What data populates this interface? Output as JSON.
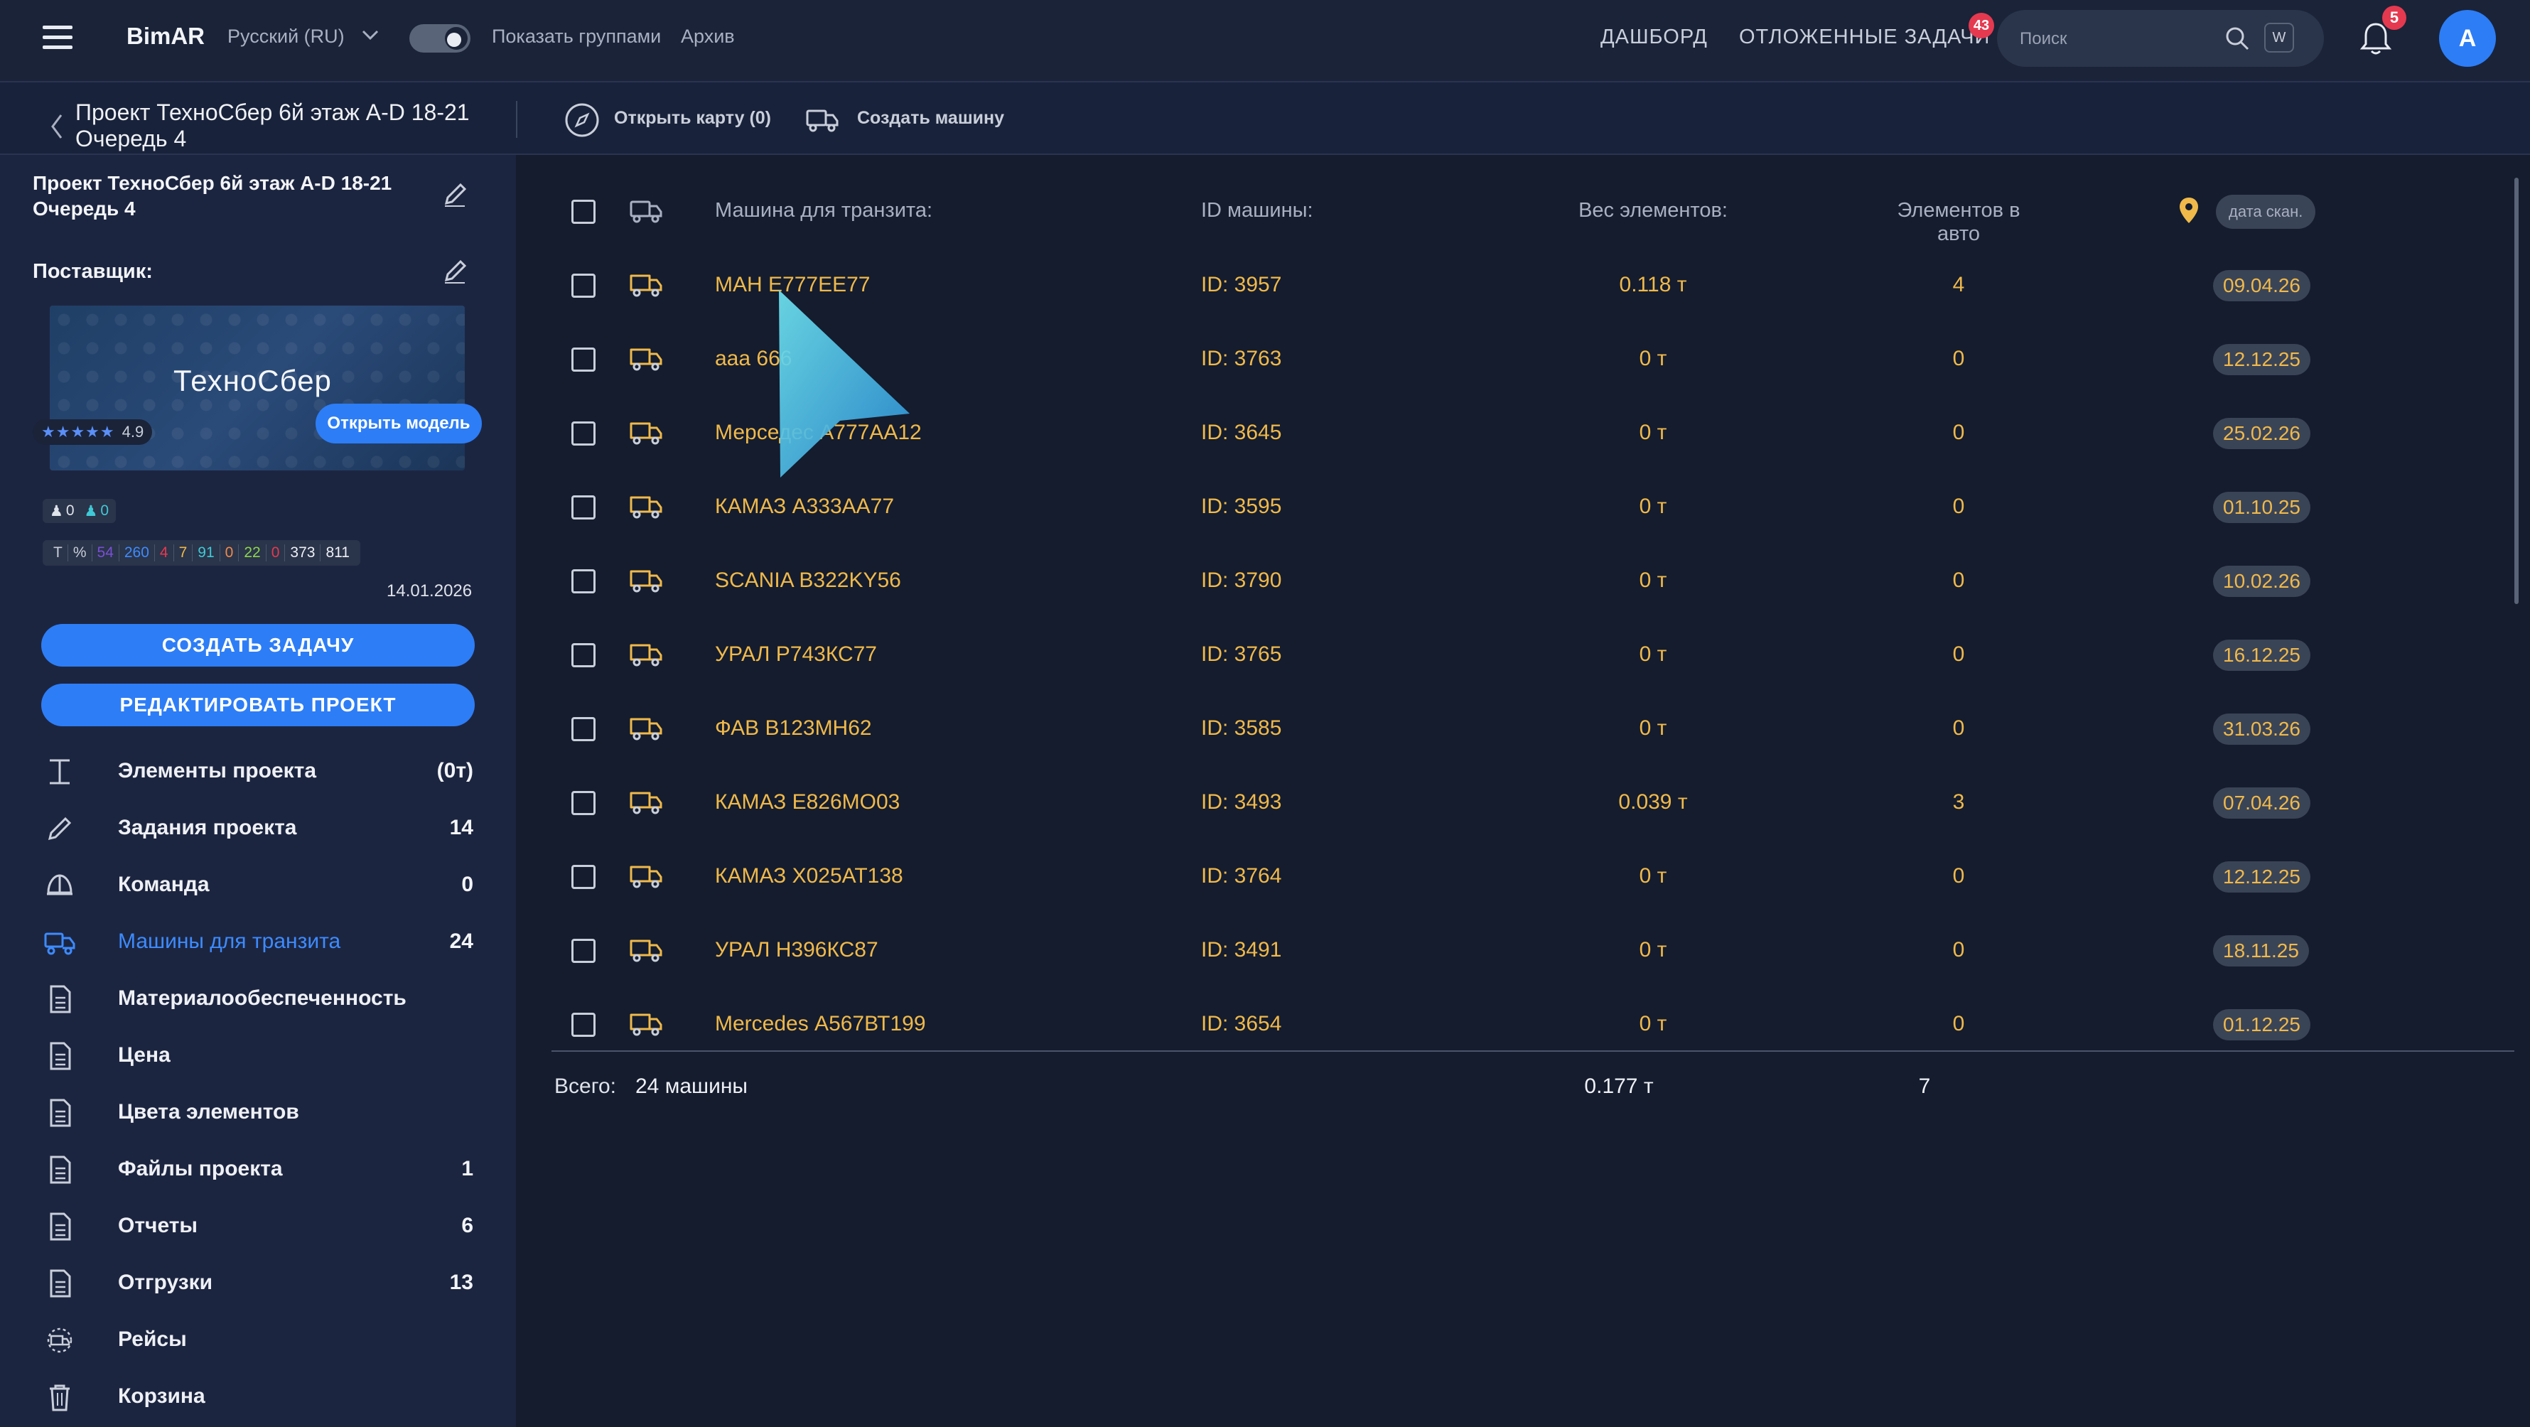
{
  "topbar": {
    "brand": "BimAR",
    "language": "Русский (RU)",
    "show_groups": "Показать группами",
    "archive": "Архив",
    "nav_dashboard": "ДАШБОРД",
    "nav_deferred": "ОТЛОЖЕННЫЕ ЗАДАЧИ",
    "deferred_badge": "43",
    "search_placeholder": "Поиск",
    "search_key": "W",
    "notif_badge": "5",
    "avatar": "A"
  },
  "subbar": {
    "project_title": "Проект ТехноСбер 6й этаж A-D 18-21 Очередь 4",
    "open_map": "Открыть карту (0)",
    "create_car": "Создать машину"
  },
  "sidebar": {
    "title": "Проект ТехноСбер 6й этаж A-D 18-21 Очередь 4",
    "supplier_label": "Поставщик:",
    "logo_text": "ТехноСбер",
    "stars": "★★★★★",
    "rating": "4.9",
    "open_model": "Открыть модель",
    "count_a": "0",
    "count_b": "0",
    "stats": [
      {
        "v": "T",
        "c": "#c9cfda"
      },
      {
        "v": "%",
        "c": "#c9cfda"
      },
      {
        "v": "54",
        "c": "#7a4fd6"
      },
      {
        "v": "260",
        "c": "#3d8bff"
      },
      {
        "v": "4",
        "c": "#e53950"
      },
      {
        "v": "7",
        "c": "#f0b94a"
      },
      {
        "v": "91",
        "c": "#3fc9d6"
      },
      {
        "v": "0",
        "c": "#f08a4a"
      },
      {
        "v": "22",
        "c": "#8bd64a"
      },
      {
        "v": "0",
        "c": "#e53950"
      },
      {
        "v": "373",
        "c": "#eef0f5"
      },
      {
        "v": "811",
        "c": "#eef0f5"
      }
    ],
    "date": "14.01.2026",
    "create_task": "СОЗДАТЬ ЗАДАЧУ",
    "edit_project": "РЕДАКТИРОВАТЬ ПРОЕКТ",
    "menu": [
      {
        "label": "Элементы проекта",
        "count": "(0т)",
        "icon": "beam-icon"
      },
      {
        "label": "Задания проекта",
        "count": "14",
        "icon": "pencil-icon"
      },
      {
        "label": "Команда",
        "count": "0",
        "icon": "helmet-icon"
      },
      {
        "label": "Машины для транзита",
        "count": "24",
        "icon": "truck-icon"
      },
      {
        "label": "Материалообеспеченность",
        "count": "",
        "icon": "document-icon"
      },
      {
        "label": "Цена",
        "count": "",
        "icon": "document-icon"
      },
      {
        "label": "Цвета элементов",
        "count": "",
        "icon": "document-icon"
      },
      {
        "label": "Файлы проекта",
        "count": "1",
        "icon": "document-icon"
      },
      {
        "label": "Отчеты",
        "count": "6",
        "icon": "document-icon"
      },
      {
        "label": "Отгрузки",
        "count": "13",
        "icon": "document-icon"
      },
      {
        "label": "Рейсы",
        "count": "",
        "icon": "route-icon"
      },
      {
        "label": "Корзина",
        "count": "",
        "icon": "trash-icon"
      }
    ]
  },
  "table": {
    "headers": {
      "name": "Машина для транзита:",
      "id": "ID машины:",
      "weight": "Вес элементов:",
      "count": "Элементов в авто",
      "date": "дата скан."
    },
    "rows": [
      {
        "name": "МАН Е777ЕЕ77",
        "id": "ID: 3957",
        "weight": "0.118 т",
        "count": "4",
        "date": "09.04.26"
      },
      {
        "name": "ааа 666",
        "id": "ID: 3763",
        "weight": "0 т",
        "count": "0",
        "date": "12.12.25"
      },
      {
        "name": "Мерседес А777АА12",
        "id": "ID: 3645",
        "weight": "0 т",
        "count": "0",
        "date": "25.02.26"
      },
      {
        "name": "КАМАЗ А333АА77",
        "id": "ID: 3595",
        "weight": "0 т",
        "count": "0",
        "date": "01.10.25"
      },
      {
        "name": "SCANIA B322KY56",
        "id": "ID: 3790",
        "weight": "0 т",
        "count": "0",
        "date": "10.02.26"
      },
      {
        "name": "УРАЛ Р743КС77",
        "id": "ID: 3765",
        "weight": "0 т",
        "count": "0",
        "date": "16.12.25"
      },
      {
        "name": "ФАВ В123МН62",
        "id": "ID: 3585",
        "weight": "0 т",
        "count": "0",
        "date": "31.03.26"
      },
      {
        "name": "КАМАЗ Е826МО03",
        "id": "ID: 3493",
        "weight": "0.039 т",
        "count": "3",
        "date": "07.04.26"
      },
      {
        "name": "КАМАЗ Х025АТ138",
        "id": "ID: 3764",
        "weight": "0 т",
        "count": "0",
        "date": "12.12.25"
      },
      {
        "name": "УРАЛ Н396КС87",
        "id": "ID: 3491",
        "weight": "0 т",
        "count": "0",
        "date": "18.11.25"
      },
      {
        "name": "Mercedes А567ВТ199",
        "id": "ID: 3654",
        "weight": "0 т",
        "count": "0",
        "date": "01.12.25"
      }
    ],
    "total_label": "Всего:",
    "total_cars": "24 машины",
    "total_weight": "0.177 т",
    "total_count": "7"
  }
}
